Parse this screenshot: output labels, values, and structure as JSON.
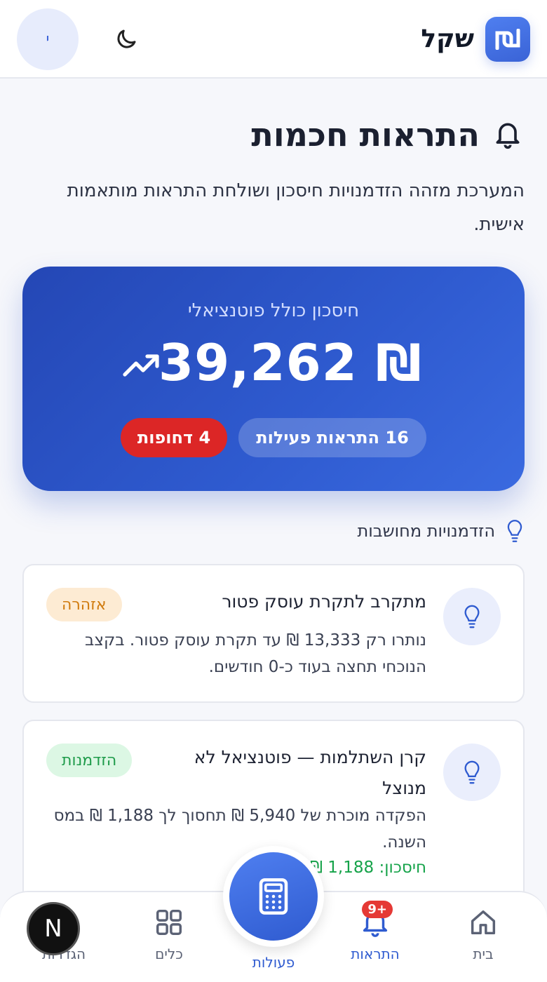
{
  "header": {
    "logo_text": "שקל",
    "avatar_initial": "י"
  },
  "page": {
    "title": "התראות חכמות",
    "subtitle": "המערכת מזהה הזדמנויות חיסכון ושולחת התראות מותאמות אישית."
  },
  "hero": {
    "label": "חיסכון כולל פוטנציאלי",
    "amount": "₪ 39,262",
    "active_pill": "16 התראות פעילות",
    "urgent_pill": "4 דחופות"
  },
  "section": {
    "title": "הזדמנויות מחושבות"
  },
  "cards": [
    {
      "title": "מתקרב לתקרת עוסק פטור",
      "body": "נותרו רק 13,333 ₪ עד תקרת עוסק פטור. בקצב הנוכחי תחצה בעוד כ-0 חודשים.",
      "badge": "אזהרה"
    },
    {
      "title": "קרן השתלמות — פוטנציאל לא מנוצל",
      "body": "הפקדה מוכרת של 5,940 ₪ תחסוך לך 1,188 ₪ במס השנה.",
      "badge": "הזדמנות",
      "saving": "חיסכון: 1,188 ₪"
    }
  ],
  "nav": {
    "home": "בית",
    "alerts": "התראות",
    "alerts_badge": "+9",
    "actions": "פעולות",
    "tools": "כלים",
    "settings": "הגדרות",
    "dev_avatar": "N"
  },
  "colors": {
    "primary": "#2f5bd0",
    "urgent": "#dc2626",
    "warning_bg": "#fdebd3",
    "opportunity_bg": "#dcf7e4"
  }
}
